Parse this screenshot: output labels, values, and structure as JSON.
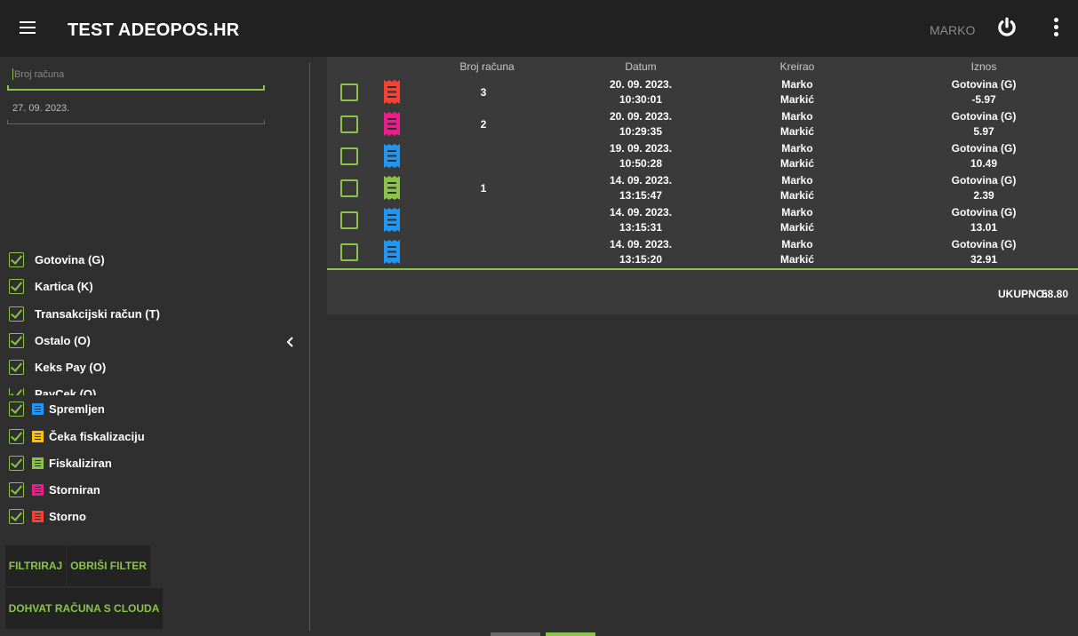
{
  "app": {
    "title": "TEST ADEOPOS.HR",
    "user": "MARKO"
  },
  "filters": {
    "receipt_number_placeholder": "Broj računa",
    "date_value": "27. 09. 2023."
  },
  "payment_types": [
    "Gotovina (G)",
    "Kartica (K)",
    "Transakcijski račun (T)",
    "Ostalo (O)",
    "Keks Pay (O)",
    "PayCek (O)"
  ],
  "statuses": [
    {
      "label": "Spremljen",
      "color": "#2196f3"
    },
    {
      "label": "Čeka fiskalizaciju",
      "color": "#ffc107"
    },
    {
      "label": "Fiskaliziran",
      "color": "#8bc34a"
    },
    {
      "label": "Storniran",
      "color": "#e91e8c"
    },
    {
      "label": "Storno",
      "color": "#f44336"
    }
  ],
  "buttons": {
    "filter": "FILTRIRAJ",
    "clear_filter": "OBRIŠI FILTER",
    "cloud_fetch": "DOHVAT RAČUNA S CLOUDA"
  },
  "table": {
    "headers": {
      "number": "Broj računa",
      "date": "Datum",
      "created": "Kreirao",
      "amount": "Iznos"
    },
    "rows": [
      {
        "number": "3",
        "date": "20. 09. 2023.",
        "time": "10:30:01",
        "first": "Marko",
        "last": "Markić",
        "payment": "Gotovina (G)",
        "amount": "-5.97",
        "color": "#f44336"
      },
      {
        "number": "2",
        "date": "20. 09. 2023.",
        "time": "10:29:35",
        "first": "Marko",
        "last": "Markić",
        "payment": "Gotovina (G)",
        "amount": "5.97",
        "color": "#e91e8c"
      },
      {
        "number": "",
        "date": "19. 09. 2023.",
        "time": "10:50:28",
        "first": "Marko",
        "last": "Markić",
        "payment": "Gotovina (G)",
        "amount": "10.49",
        "color": "#2196f3"
      },
      {
        "number": "1",
        "date": "14. 09. 2023.",
        "time": "13:15:47",
        "first": "Marko",
        "last": "Markić",
        "payment": "Gotovina (G)",
        "amount": "2.39",
        "color": "#8bc34a"
      },
      {
        "number": "",
        "date": "14. 09. 2023.",
        "time": "13:15:31",
        "first": "Marko",
        "last": "Markić",
        "payment": "Gotovina (G)",
        "amount": "13.01",
        "color": "#2196f3"
      },
      {
        "number": "",
        "date": "14. 09. 2023.",
        "time": "13:15:20",
        "first": "Marko",
        "last": "Markić",
        "payment": "Gotovina (G)",
        "amount": "32.91",
        "color": "#2196f3"
      }
    ],
    "total_label": "UKUPNO:",
    "total_value": "58.80"
  },
  "icons": {
    "menu": "hamburger-menu-icon",
    "power": "power-icon",
    "more": "kebab-menu-icon",
    "collapse": "chevron-left-icon",
    "receipt": "receipt-icon"
  }
}
